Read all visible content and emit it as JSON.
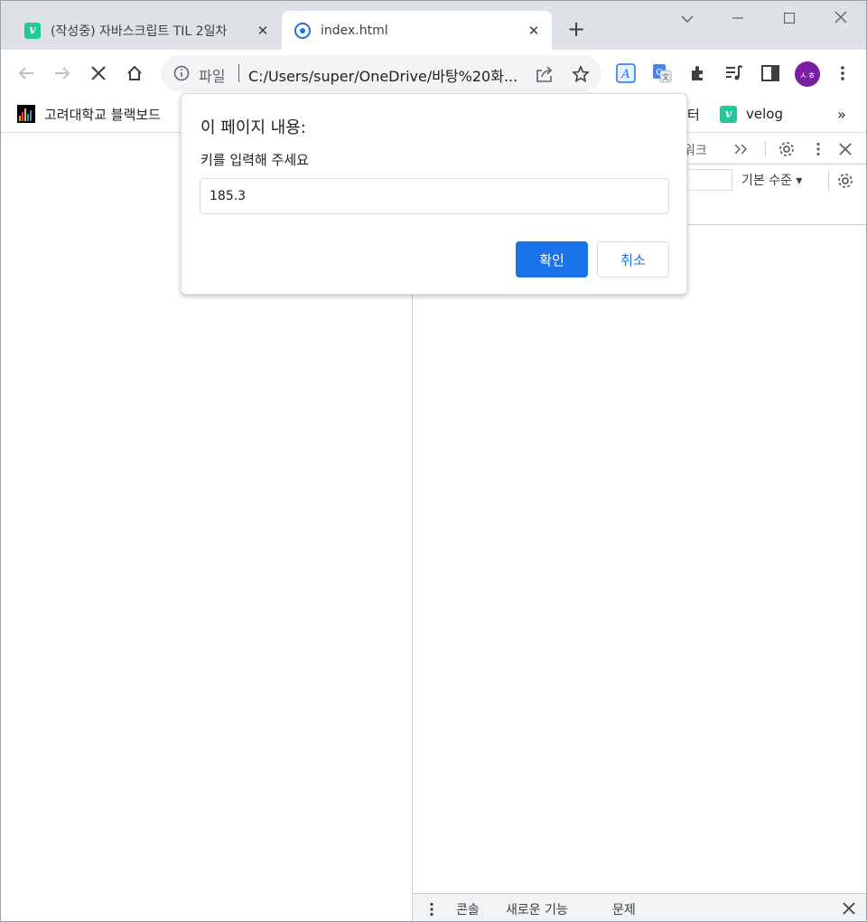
{
  "tabs": [
    {
      "title": "(작성중) 자바스크립트 TIL 2일차",
      "icon": "velog-icon",
      "active": false
    },
    {
      "title": "index.html",
      "icon": "chrome-file-icon",
      "active": true
    }
  ],
  "omnibox": {
    "scheme_label": "파일",
    "url": "C:/Users/super/OneDrive/바탕%20화..."
  },
  "bookmarks": [
    {
      "label": "고려대학교 블랙보드",
      "icon": "blackboard-icon"
    },
    {
      "label": "터",
      "icon": ""
    },
    {
      "label": "velog",
      "icon": "velog-icon"
    }
  ],
  "bookmarks_overflow": "»",
  "profile": {
    "initials": "ㅅㅎ",
    "color": "#7b1fa2"
  },
  "devtools": {
    "tab_visible": "워크",
    "log_level": "기본 수준 ▾",
    "drawer_tabs": [
      "콘솔",
      "새로운 기능",
      "문제"
    ]
  },
  "dialog": {
    "title": "이 페이지 내용:",
    "message": "키를 입력해 주세요",
    "input_value": "185.3",
    "ok_label": "확인",
    "cancel_label": "취소"
  },
  "colors": {
    "accent": "#1a73e8",
    "tabstrip": "#dee1e6",
    "velog": "#20c997"
  }
}
